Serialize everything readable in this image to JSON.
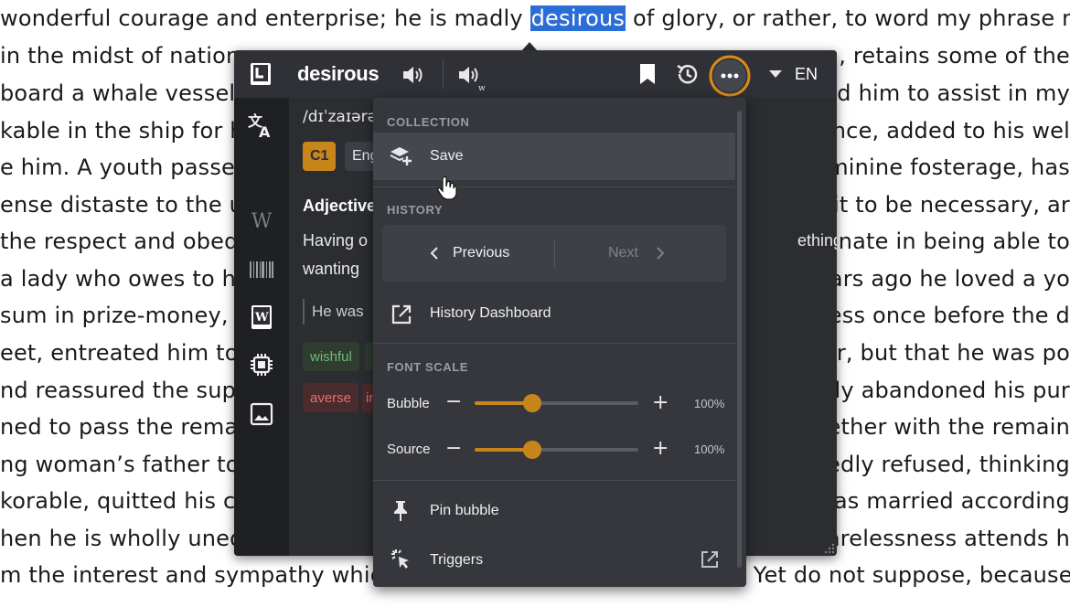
{
  "book": {
    "lines": [
      {
        "left": "wonderful courage and enterprise; he is madly ",
        "word": "desirous",
        "right": " of glory, or rather, to word my phrase more cha"
      },
      {
        "left": "in the midst of nation",
        "right": ", retains some of the"
      },
      {
        "left": "board a whale vessel;",
        "right": "ged him to assist in my"
      },
      {
        "left": "kable in the ship for his",
        "right": "tance, added to his wel"
      },
      {
        "left": "e him. A youth passed",
        "right": "eminine fosterage, has"
      },
      {
        "left": "ense distaste to the us",
        "right": "d it to be necessary, ar"
      },
      {
        "left": "the respect and obedie",
        "right": "unate in being able to"
      },
      {
        "left": "a lady who owes to him",
        "right": "years ago he loved a yo"
      },
      {
        "left": "sum in prize-money, th",
        "right": "tress once before the d"
      },
      {
        "left": "eet, entreated him to s",
        "right": "her, but that he was po"
      },
      {
        "left": "nd reassured the suppli",
        "right": "ntly abandoned his pur"
      },
      {
        "left": "ned to pass the remain",
        "right": "gether with the remain"
      },
      {
        "left": "ng woman’s father to c",
        "right": "tidedly refused, thinking"
      },
      {
        "left": "korable, quitted his cou",
        "right": "was married according"
      },
      {
        "left": "hen he is wholly uned",
        "right": "carelessness attends h"
      },
      {
        "left": "m the interest and sympathy which otherwise he would command. Yet do not suppose, because I comp",
        "right": ""
      }
    ]
  },
  "popup": {
    "headword": "desirous",
    "language": "EN",
    "phonetic": "/dɪˈzaɪərə",
    "level": "C1",
    "lang_tag": "Eng",
    "pos": "Adjective",
    "definition_line1": "Having o",
    "definition_line1_right": "ething;",
    "definition_line2": "wanting",
    "example": "He was",
    "synonym": "wishful",
    "antonym": "averse",
    "antonym_partial": "in",
    "icons": {
      "logo": "app-logo-icon",
      "speak_us": "speaker-icon",
      "speak_uk": "speaker-alt-icon",
      "bookmark": "bookmark-icon",
      "history": "history-icon",
      "more": "more-options-icon",
      "lang_dropdown": "caret-down-icon"
    },
    "sidebar": [
      "translate-icon",
      "wikipedia-icon",
      "barcode-icon",
      "wiktionary-icon",
      "chip-icon",
      "image-icon"
    ],
    "accent": "#d98b1a",
    "level_color": "#c7851c"
  },
  "menu": {
    "collection_header": "COLLECTION",
    "save_label": "Save",
    "history_header": "HISTORY",
    "previous_label": "Previous",
    "next_label": "Next",
    "dashboard_label": "History Dashboard",
    "font_scale_header": "FONT SCALE",
    "bubble_label": "Bubble",
    "bubble_pct": "100%",
    "bubble_value": 0.35,
    "source_label": "Source",
    "source_pct": "100%",
    "source_value": 0.35,
    "minus": "−",
    "plus": "+",
    "pin_label": "Pin bubble",
    "triggers_label": "Triggers"
  }
}
